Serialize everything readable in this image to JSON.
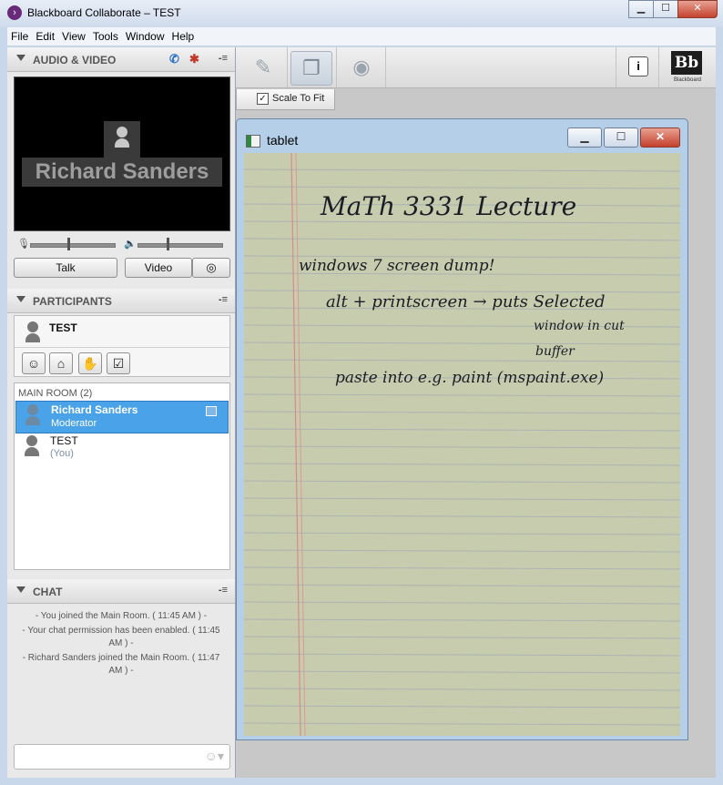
{
  "window": {
    "title": "Blackboard Collaborate – TEST",
    "app_icon": "collaborate-icon"
  },
  "title_buttons": {
    "minimize": "▁",
    "maximize": "☐",
    "close": "✕"
  },
  "menubar": {
    "items": [
      "File",
      "Edit",
      "View",
      "Tools",
      "Window",
      "Help"
    ]
  },
  "audio_video": {
    "header": "AUDIO & VIDEO",
    "menu_glyph": "-≡",
    "video_name": "Richard Sanders",
    "mic_level": 0.45,
    "speaker_level": 0.35,
    "talk_label": "Talk",
    "video_label": "Video"
  },
  "participants": {
    "header": "PARTICIPANTS",
    "menu_glyph": "-≡",
    "self_name": "TEST",
    "room_label": "MAIN ROOM",
    "room_count": "(2)",
    "list": [
      {
        "name": "Richard Sanders",
        "role": "Moderator",
        "selected": true
      },
      {
        "name": "TEST",
        "role": "(You)",
        "selected": false
      }
    ]
  },
  "chat": {
    "header": "CHAT",
    "menu_glyph": "-≡",
    "messages": [
      "- You joined the Main Room. ( 11:45 AM ) -",
      "- Your chat permission has been enabled. ( 11:45 AM ) -",
      "- Richard Sanders joined the Main Room. ( 11:47 AM ) -"
    ],
    "input_placeholder": ""
  },
  "toolbar": {
    "scale_to_fit_label": "Scale To Fit",
    "scale_to_fit_checked": "✓",
    "info_label": "i",
    "logo_text": "Bb",
    "logo_caption": "Blackboard"
  },
  "app_window": {
    "title": "tablet",
    "min": "▁",
    "max": "☐",
    "close": "✕"
  },
  "notes": {
    "line1": "MaTh 3331 Lecture",
    "line2": "windows 7  screen dump!",
    "line3": "alt + printscreen → puts Selected",
    "line4": "window in cut",
    "line5": "buffer",
    "line6": "paste into e.g. paint (mspaint.exe)"
  }
}
